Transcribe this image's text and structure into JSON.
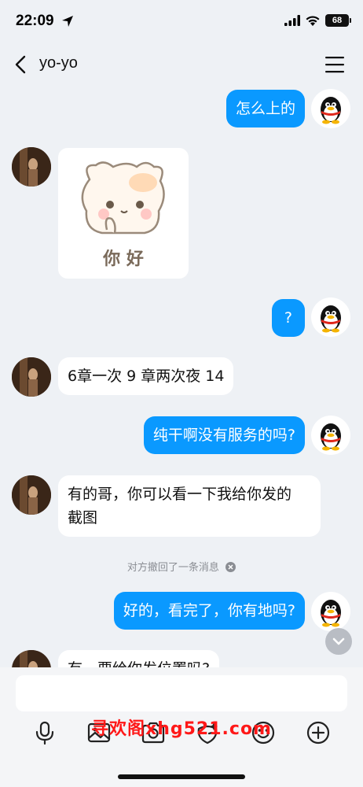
{
  "status_bar": {
    "time": "22:09",
    "battery": "68",
    "icons": [
      "location-arrow-icon",
      "signal-icon",
      "wifi-icon",
      "battery-icon"
    ]
  },
  "nav": {
    "title": "yo-yo",
    "back_icon": "chevron-left-icon",
    "menu_icon": "hamburger-menu-icon"
  },
  "messages": [
    {
      "side": "out",
      "text": "怎么上的"
    },
    {
      "side": "in",
      "type": "sticker",
      "text": "你 好"
    },
    {
      "side": "out",
      "text": "?"
    },
    {
      "side": "in",
      "text": "6章一次 9 章两次夜 14"
    },
    {
      "side": "out",
      "text": "纯干啊没有服务的吗?"
    },
    {
      "side": "in",
      "text": "有的哥，你可以看一下我给你发的",
      "text_line2": "截图"
    },
    {
      "side": "out",
      "text": "好的，看完了，你有地吗?"
    },
    {
      "side": "in",
      "text": "有，要给你发位置吗?"
    }
  ],
  "system_notice": "对方撤回了一条消息",
  "input": {
    "placeholder": "",
    "value": ""
  },
  "toolbar": [
    "microphone-icon",
    "image-icon",
    "camera-icon",
    "sticker-icon",
    "emoji-icon",
    "plus-icon"
  ],
  "watermark": "寻欢阁xhg521.com",
  "colors": {
    "outgoing_bubble": "#0a99ff",
    "incoming_bubble": "#ffffff",
    "background": "#eef1f5",
    "watermark": "#ff1818"
  }
}
